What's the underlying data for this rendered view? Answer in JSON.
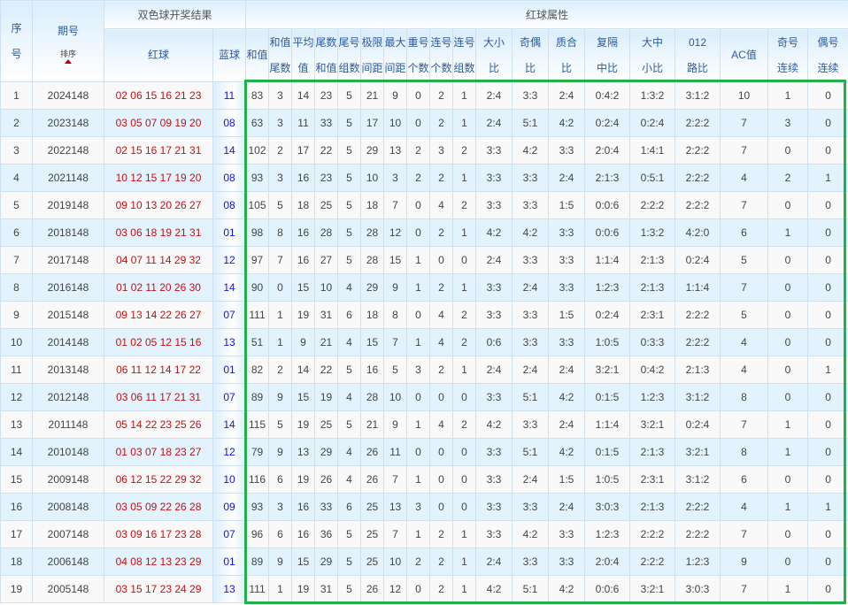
{
  "header": {
    "seq": [
      "序",
      "号"
    ],
    "issue": "期号",
    "sort_label": "排序",
    "result_group": "双色球开奖结果",
    "attr_group": "红球属性",
    "red": "红球",
    "blue": "蓝球",
    "columns": [
      [
        "和值"
      ],
      [
        "和值",
        "尾数"
      ],
      [
        "平均",
        "值"
      ],
      [
        "尾数",
        "和值"
      ],
      [
        "尾号",
        "组数"
      ],
      [
        "极限",
        "间距"
      ],
      [
        "最大",
        "间距"
      ],
      [
        "重号",
        "个数"
      ],
      [
        "连号",
        "个数"
      ],
      [
        "连号",
        "组数"
      ],
      [
        "大小",
        "比"
      ],
      [
        "奇偶",
        "比"
      ],
      [
        "质合",
        "比"
      ],
      [
        "复隔",
        "中比"
      ],
      [
        "大中",
        "小比"
      ],
      [
        "012",
        "路比"
      ],
      [
        "AC值"
      ],
      [
        "奇号",
        "连续"
      ],
      [
        "偶号",
        "连续"
      ]
    ]
  },
  "rows": [
    [
      "1",
      "2024148",
      "02 06 15 16 21 23",
      "11",
      [
        "83",
        "3",
        "14",
        "23",
        "5",
        "21",
        "9",
        "0",
        "2",
        "1",
        "2:4",
        "3:3",
        "2:4",
        "0:4:2",
        "1:3:2",
        "3:1:2",
        "10",
        "1",
        "0"
      ]
    ],
    [
      "2",
      "2023148",
      "03 05 07 09 19 20",
      "08",
      [
        "63",
        "3",
        "11",
        "33",
        "5",
        "17",
        "10",
        "0",
        "2",
        "1",
        "2:4",
        "5:1",
        "4:2",
        "0:2:4",
        "0:2:4",
        "2:2:2",
        "7",
        "3",
        "0"
      ]
    ],
    [
      "3",
      "2022148",
      "02 15 16 17 21 31",
      "14",
      [
        "102",
        "2",
        "17",
        "22",
        "5",
        "29",
        "13",
        "2",
        "3",
        "2",
        "3:3",
        "4:2",
        "3:3",
        "2:0:4",
        "1:4:1",
        "2:2:2",
        "7",
        "0",
        "0"
      ]
    ],
    [
      "4",
      "2021148",
      "10 12 15 17 19 20",
      "08",
      [
        "93",
        "3",
        "16",
        "23",
        "5",
        "10",
        "3",
        "2",
        "2",
        "1",
        "3:3",
        "3:3",
        "2:4",
        "2:1:3",
        "0:5:1",
        "2:2:2",
        "4",
        "2",
        "1"
      ]
    ],
    [
      "5",
      "2019148",
      "09 10 13 20 26 27",
      "08",
      [
        "105",
        "5",
        "18",
        "25",
        "5",
        "18",
        "7",
        "0",
        "4",
        "2",
        "3:3",
        "3:3",
        "1:5",
        "0:0:6",
        "2:2:2",
        "2:2:2",
        "7",
        "0",
        "0"
      ]
    ],
    [
      "6",
      "2018148",
      "03 06 18 19 21 31",
      "01",
      [
        "98",
        "8",
        "16",
        "28",
        "5",
        "28",
        "12",
        "0",
        "2",
        "1",
        "4:2",
        "4:2",
        "3:3",
        "0:0:6",
        "1:3:2",
        "4:2:0",
        "6",
        "1",
        "0"
      ]
    ],
    [
      "7",
      "2017148",
      "04 07 11 14 29 32",
      "12",
      [
        "97",
        "7",
        "16",
        "27",
        "5",
        "28",
        "15",
        "1",
        "0",
        "0",
        "2:4",
        "3:3",
        "3:3",
        "1:1:4",
        "2:1:3",
        "0:2:4",
        "5",
        "0",
        "0"
      ]
    ],
    [
      "8",
      "2016148",
      "01 02 11 20 26 30",
      "14",
      [
        "90",
        "0",
        "15",
        "10",
        "4",
        "29",
        "9",
        "1",
        "2",
        "1",
        "3:3",
        "2:4",
        "3:3",
        "1:2:3",
        "2:1:3",
        "1:1:4",
        "7",
        "0",
        "0"
      ]
    ],
    [
      "9",
      "2015148",
      "09 13 14 22 26 27",
      "07",
      [
        "111",
        "1",
        "19",
        "31",
        "6",
        "18",
        "8",
        "0",
        "4",
        "2",
        "3:3",
        "3:3",
        "1:5",
        "0:2:4",
        "2:3:1",
        "2:2:2",
        "5",
        "0",
        "0"
      ]
    ],
    [
      "10",
      "2014148",
      "01 02 05 12 15 16",
      "13",
      [
        "51",
        "1",
        "9",
        "21",
        "4",
        "15",
        "7",
        "1",
        "4",
        "2",
        "0:6",
        "3:3",
        "3:3",
        "1:0:5",
        "0:3:3",
        "2:2:2",
        "4",
        "0",
        "0"
      ]
    ],
    [
      "11",
      "2013148",
      "06 11 12 14 17 22",
      "01",
      [
        "82",
        "2",
        "14",
        "22",
        "5",
        "16",
        "5",
        "3",
        "2",
        "1",
        "2:4",
        "2:4",
        "2:4",
        "3:2:1",
        "0:4:2",
        "2:1:3",
        "4",
        "0",
        "1"
      ]
    ],
    [
      "12",
      "2012148",
      "03 06 11 17 21 31",
      "07",
      [
        "89",
        "9",
        "15",
        "19",
        "4",
        "28",
        "10",
        "0",
        "0",
        "0",
        "3:3",
        "5:1",
        "4:2",
        "0:1:5",
        "1:2:3",
        "3:1:2",
        "8",
        "0",
        "0"
      ]
    ],
    [
      "13",
      "2011148",
      "05 14 22 23 25 26",
      "14",
      [
        "115",
        "5",
        "19",
        "25",
        "5",
        "21",
        "9",
        "1",
        "4",
        "2",
        "4:2",
        "3:3",
        "2:4",
        "1:1:4",
        "3:2:1",
        "0:2:4",
        "7",
        "1",
        "0"
      ]
    ],
    [
      "14",
      "2010148",
      "01 03 07 18 23 27",
      "12",
      [
        "79",
        "9",
        "13",
        "29",
        "4",
        "26",
        "11",
        "0",
        "0",
        "0",
        "3:3",
        "5:1",
        "4:2",
        "0:1:5",
        "2:1:3",
        "3:2:1",
        "8",
        "1",
        "0"
      ]
    ],
    [
      "15",
      "2009148",
      "06 12 15 22 29 32",
      "10",
      [
        "116",
        "6",
        "19",
        "26",
        "4",
        "26",
        "7",
        "1",
        "0",
        "0",
        "3:3",
        "2:4",
        "1:5",
        "1:0:5",
        "2:3:1",
        "3:1:2",
        "6",
        "0",
        "0"
      ]
    ],
    [
      "16",
      "2008148",
      "03 05 09 22 26 28",
      "09",
      [
        "93",
        "3",
        "16",
        "33",
        "6",
        "25",
        "13",
        "3",
        "0",
        "0",
        "3:3",
        "3:3",
        "2:4",
        "3:0:3",
        "2:1:3",
        "2:2:2",
        "4",
        "1",
        "1"
      ]
    ],
    [
      "17",
      "2007148",
      "03 09 16 17 23 28",
      "07",
      [
        "96",
        "6",
        "16",
        "36",
        "5",
        "25",
        "7",
        "1",
        "2",
        "1",
        "3:3",
        "4:2",
        "3:3",
        "1:2:3",
        "2:2:2",
        "2:2:2",
        "7",
        "0",
        "0"
      ]
    ],
    [
      "18",
      "2006148",
      "04 08 12 13 23 29",
      "01",
      [
        "89",
        "9",
        "15",
        "29",
        "5",
        "25",
        "10",
        "2",
        "2",
        "1",
        "2:4",
        "3:3",
        "3:3",
        "2:0:4",
        "2:2:2",
        "1:2:3",
        "9",
        "0",
        "0"
      ]
    ],
    [
      "19",
      "2005148",
      "03 15 17 23 24 29",
      "13",
      [
        "111",
        "1",
        "19",
        "31",
        "5",
        "26",
        "12",
        "0",
        "2",
        "1",
        "4:2",
        "5:1",
        "4:2",
        "0:0:6",
        "3:2:1",
        "3:0:3",
        "7",
        "1",
        "0"
      ]
    ]
  ],
  "colors": {
    "red_ball": "#c21010",
    "blue_ball": "#1010ee",
    "highlight_box": "#22b04b"
  }
}
